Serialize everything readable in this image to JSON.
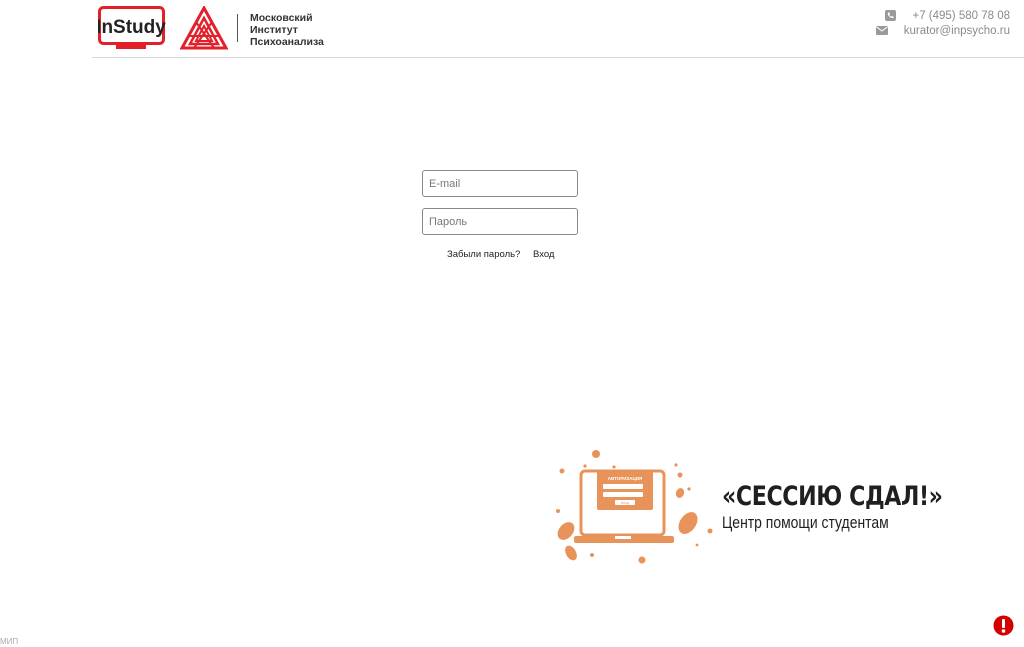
{
  "header": {
    "logo_instudy": "InStudy",
    "institute_lines": [
      "Московский",
      "Институт",
      "Психоанализа"
    ],
    "phone": "+7 (495) 580 78 08",
    "email": "kurator@inpsycho.ru",
    "icons": {
      "phone": "phone-icon",
      "email": "mail-icon"
    }
  },
  "login": {
    "email_placeholder": "E-mail",
    "email_value": "",
    "password_placeholder": "Пароль",
    "password_value": "",
    "forgot_label": "Забыли пароль?",
    "login_label": "Вход"
  },
  "banner": {
    "title": "«СЕССИЮ СДАЛ!»",
    "subtitle": "Центр помощи студентам",
    "laptop_caption": "АВТОРИЗАЦИЯ",
    "laptop_button": "ВХОД"
  },
  "footer": {
    "text": "МИП"
  },
  "colors": {
    "brand_red": "#e3202a",
    "banner_orange": "#e8935a",
    "border": "#d9d9d9"
  }
}
